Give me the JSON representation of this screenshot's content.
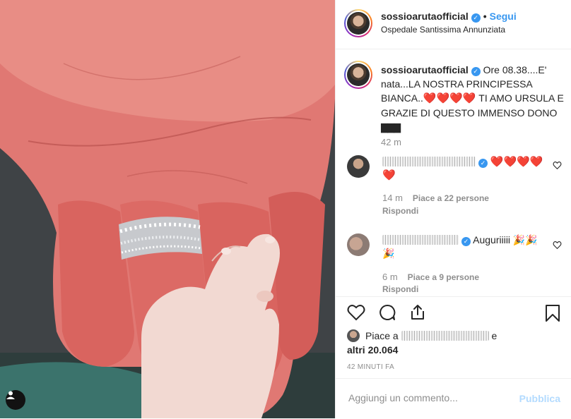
{
  "post": {
    "username": "sossioarutaofficial",
    "verified_icon": "verified-badge-icon",
    "follow_label": "Segui",
    "location": "Ospedale Santissima Annunziata"
  },
  "caption": {
    "username": "sossioarutaofficial",
    "text_1": "Ore 08.38....E' nata...LA NOSTRA PRINCIPESSA BIANCA..",
    "hearts": "❤️❤️❤️❤️",
    "text_2": "TI AMO URSULA E GRAZIE DI QUESTO IMMENSO DONO",
    "blocks": "▇▇▇",
    "time": "42 m"
  },
  "comments": [
    {
      "text": "❤️❤️❤️❤️❤️",
      "time": "14 m",
      "likes": "Piace a 22 persone",
      "reply": "Rispondi"
    },
    {
      "text": "Auguriiiii 🎉🎉🎉",
      "time": "6 m",
      "likes": "Piace a 9 persone",
      "reply": "Rispondi"
    }
  ],
  "likes": {
    "prefix": "Piace a",
    "suffix": "e",
    "others": "altri 20.064"
  },
  "time_ago": "42 MINUTI FA",
  "add_comment": {
    "placeholder": "Aggiungi un commento...",
    "publish_label": "Pubblica"
  },
  "colors": {
    "link_blue": "#3897f0",
    "publish_disabled": "#b3dbff",
    "secondary_text": "#8e8e8e"
  }
}
